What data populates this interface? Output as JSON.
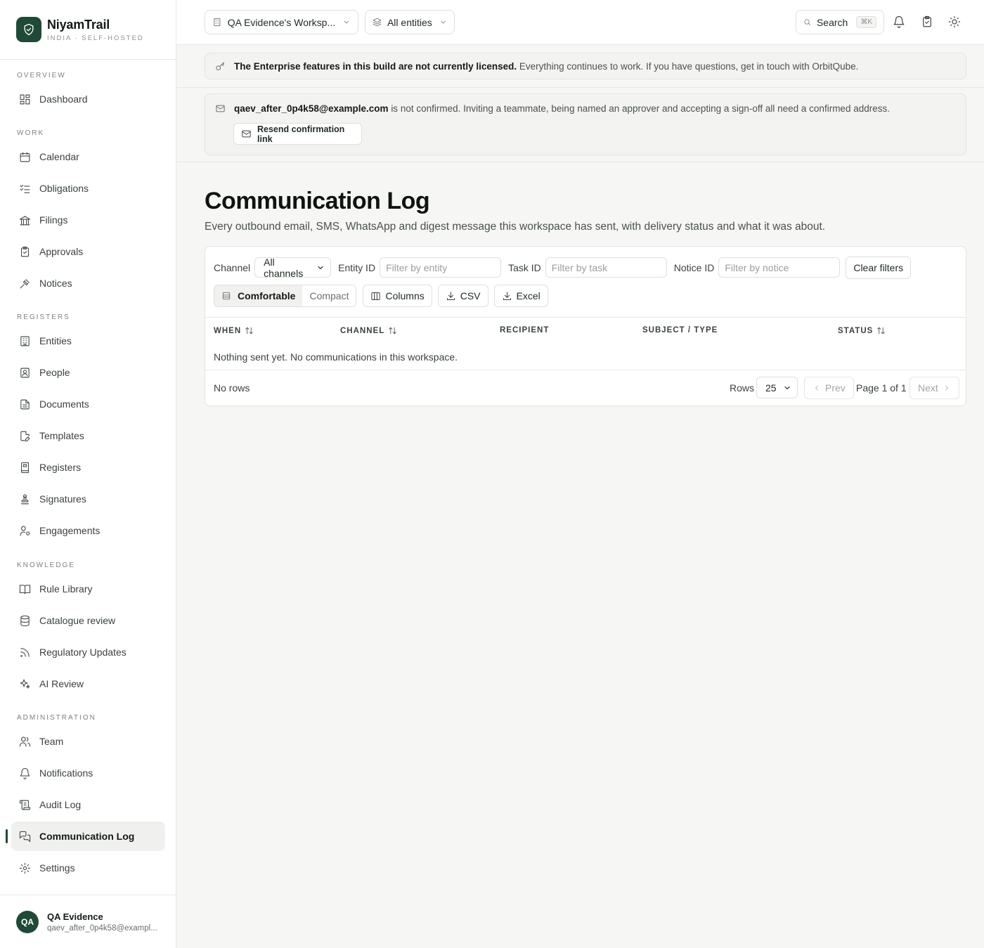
{
  "brand": {
    "name": "NiyamTrail",
    "subtitle": "INDIA · SELF-HOSTED"
  },
  "sidebar": {
    "sections": {
      "overview": "OVERVIEW",
      "work": "WORK",
      "registers": "REGISTERS",
      "knowledge": "KNOWLEDGE",
      "administration": "ADMINISTRATION"
    },
    "items": {
      "dashboard": "Dashboard",
      "calendar": "Calendar",
      "obligations": "Obligations",
      "filings": "Filings",
      "approvals": "Approvals",
      "notices": "Notices",
      "entities": "Entities",
      "people": "People",
      "documents": "Documents",
      "templates": "Templates",
      "registers": "Registers",
      "signatures": "Signatures",
      "engagements": "Engagements",
      "rule_library": "Rule Library",
      "catalogue_review": "Catalogue review",
      "regulatory_updates": "Regulatory Updates",
      "ai_review": "AI Review",
      "team": "Team",
      "notifications": "Notifications",
      "audit_log": "Audit Log",
      "communication_log": "Communication Log",
      "settings": "Settings"
    },
    "active": "communication_log"
  },
  "user": {
    "initials": "QA",
    "name": "QA Evidence",
    "email": "qaev_after_0p4k58@exampl..."
  },
  "topbar": {
    "workspace": "QA Evidence's Worksp...",
    "entities": "All entities",
    "search": "Search",
    "shortcut": "⌘K"
  },
  "license_banner": {
    "strong": "The Enterprise features in this build are not currently licensed.",
    "text": "Everything continues to work. If you have questions, get in touch with OrbitQube."
  },
  "confirm_banner": {
    "email": "qaev_after_0p4k58@example.com",
    "text": "is not confirmed. Inviting a teammate, being named an approver and accepting a sign-off all need a confirmed address.",
    "button": "Resend confirmation link"
  },
  "page": {
    "title": "Communication Log",
    "subtitle": "Every outbound email, SMS, WhatsApp and digest message this workspace has sent, with delivery status and what it was about."
  },
  "filters": {
    "channel_label": "Channel",
    "channel_value": "All channels",
    "entity_label": "Entity ID",
    "entity_placeholder": "Filter by entity",
    "task_label": "Task ID",
    "task_placeholder": "Filter by task",
    "notice_label": "Notice ID",
    "notice_placeholder": "Filter by notice",
    "clear": "Clear filters"
  },
  "toolbar": {
    "comfortable": "Comfortable",
    "compact": "Compact",
    "columns": "Columns",
    "csv": "CSV",
    "excel": "Excel"
  },
  "table": {
    "columns": [
      "WHEN",
      "CHANNEL",
      "RECIPIENT",
      "SUBJECT / TYPE",
      "STATUS"
    ],
    "empty": "Nothing sent yet. No communications in this workspace."
  },
  "pagination": {
    "no_rows": "No rows",
    "rows_label": "Rows",
    "rows_value": "25",
    "prev": "Prev",
    "page_info": "Page 1 of 1",
    "next": "Next"
  },
  "colors": {
    "brand": "#1f4a37",
    "background": "#f6f6f5"
  }
}
